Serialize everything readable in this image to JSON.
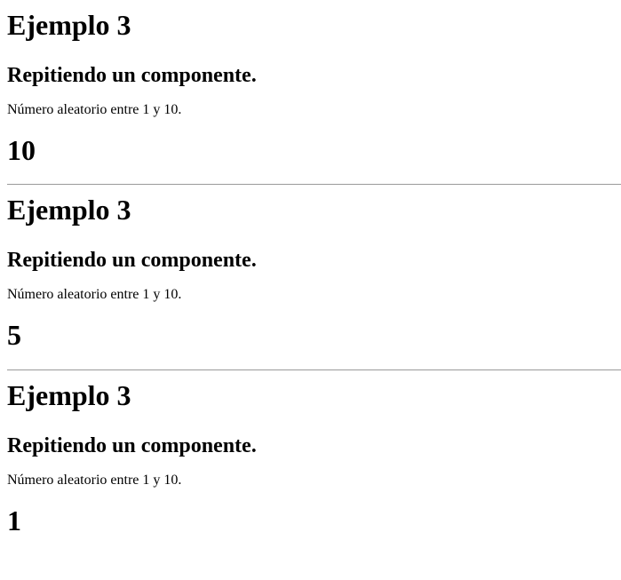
{
  "components": [
    {
      "title": "Ejemplo 3",
      "subtitle": "Repitiendo un componente.",
      "description": "Número aleatorio entre 1 y 10.",
      "number": "10"
    },
    {
      "title": "Ejemplo 3",
      "subtitle": "Repitiendo un componente.",
      "description": "Número aleatorio entre 1 y 10.",
      "number": "5"
    },
    {
      "title": "Ejemplo 3",
      "subtitle": "Repitiendo un componente.",
      "description": "Número aleatorio entre 1 y 10.",
      "number": "1"
    }
  ]
}
